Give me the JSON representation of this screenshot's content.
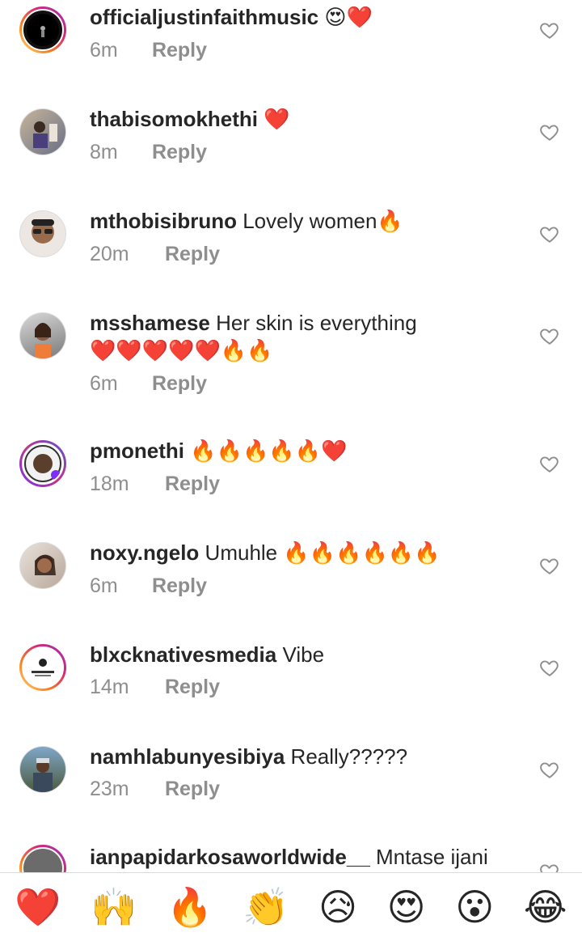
{
  "comments": [
    {
      "username": "officialjustinfaithmusic",
      "text": "",
      "emoji": "😍❤️",
      "time": "6m",
      "reply": "Reply"
    },
    {
      "username": "thabisomokhethi",
      "text": "",
      "emoji": "❤️",
      "time": "8m",
      "reply": "Reply"
    },
    {
      "username": "mthobisibruno",
      "text": "Lovely women",
      "emoji": "🔥",
      "time": "20m",
      "reply": "Reply"
    },
    {
      "username": "msshamese",
      "text": "Her skin is everything",
      "emoji": "❤️❤️❤️❤️❤️🔥🔥",
      "time": "6m",
      "reply": "Reply"
    },
    {
      "username": "pmonethi",
      "text": "",
      "emoji": "🔥🔥🔥🔥🔥❤️",
      "time": "18m",
      "reply": "Reply"
    },
    {
      "username": "noxy.ngelo",
      "text": "Umuhle",
      "emoji": "🔥🔥🔥🔥🔥🔥",
      "time": "6m",
      "reply": "Reply"
    },
    {
      "username": "blxcknativesmedia",
      "text": "Vibe",
      "emoji": "",
      "time": "14m",
      "reply": "Reply"
    },
    {
      "username": "namhlabunyesibiya",
      "text": "Really?????",
      "emoji": "",
      "time": "23m",
      "reply": "Reply"
    },
    {
      "username": "ianpapidarkosaworldwide__",
      "text": "Mntase ijani",
      "emoji": "",
      "time": "",
      "reply": ""
    }
  ],
  "quick_reactions": [
    "❤️",
    "🙌",
    "🔥",
    "👏",
    "😥",
    "😍",
    "😮",
    "😂"
  ],
  "colors": {
    "text": "#262626",
    "meta": "#8e8e8e",
    "border": "#dbdbdb"
  }
}
